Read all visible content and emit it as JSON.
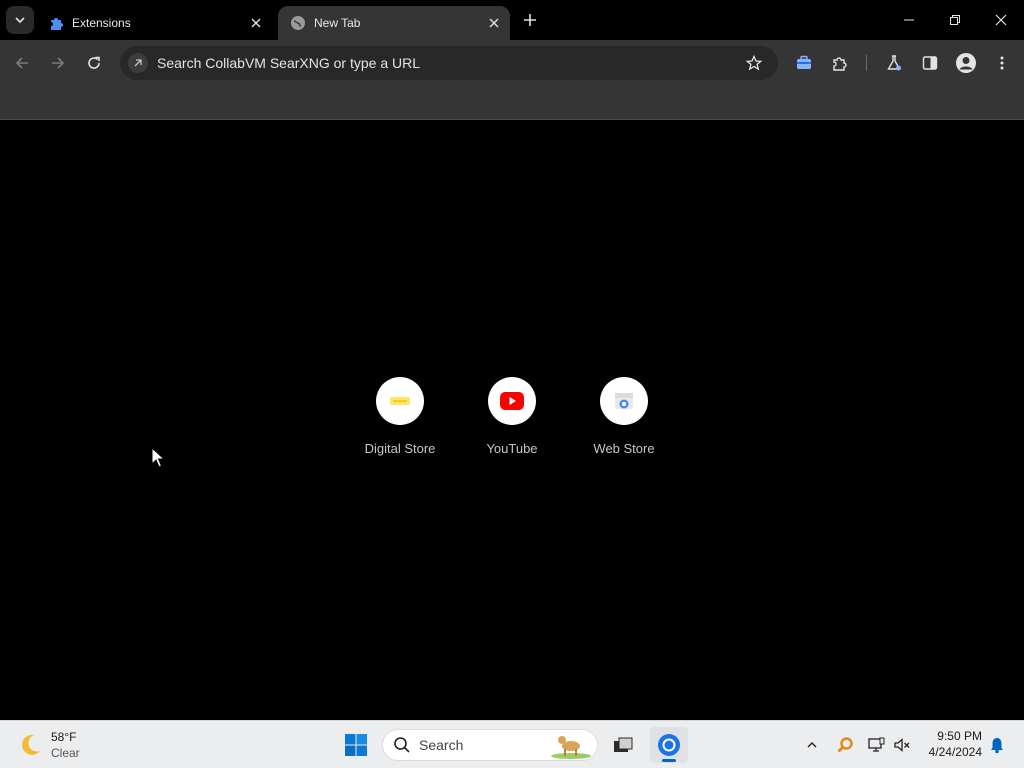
{
  "tabs": [
    {
      "title": "Extensions",
      "icon": "puzzle-icon",
      "active": false
    },
    {
      "title": "New Tab",
      "icon": "globe-icon",
      "active": true
    }
  ],
  "toolbar": {
    "omnibox_placeholder": "Search CollabVM SearXNG or type a URL"
  },
  "shortcuts": [
    {
      "label": "Digital Store",
      "icon": "digital-store-icon"
    },
    {
      "label": "YouTube",
      "icon": "youtube-icon"
    },
    {
      "label": "Web Store",
      "icon": "web-store-icon"
    }
  ],
  "taskbar": {
    "weather_temp": "58°F",
    "weather_condition": "Clear",
    "search_label": "Search",
    "time": "9:50 PM",
    "date": "4/24/2024"
  },
  "colors": {
    "accent": "#0067c0",
    "youtube_red": "#ff0000",
    "toolbar_bg": "#353535"
  }
}
